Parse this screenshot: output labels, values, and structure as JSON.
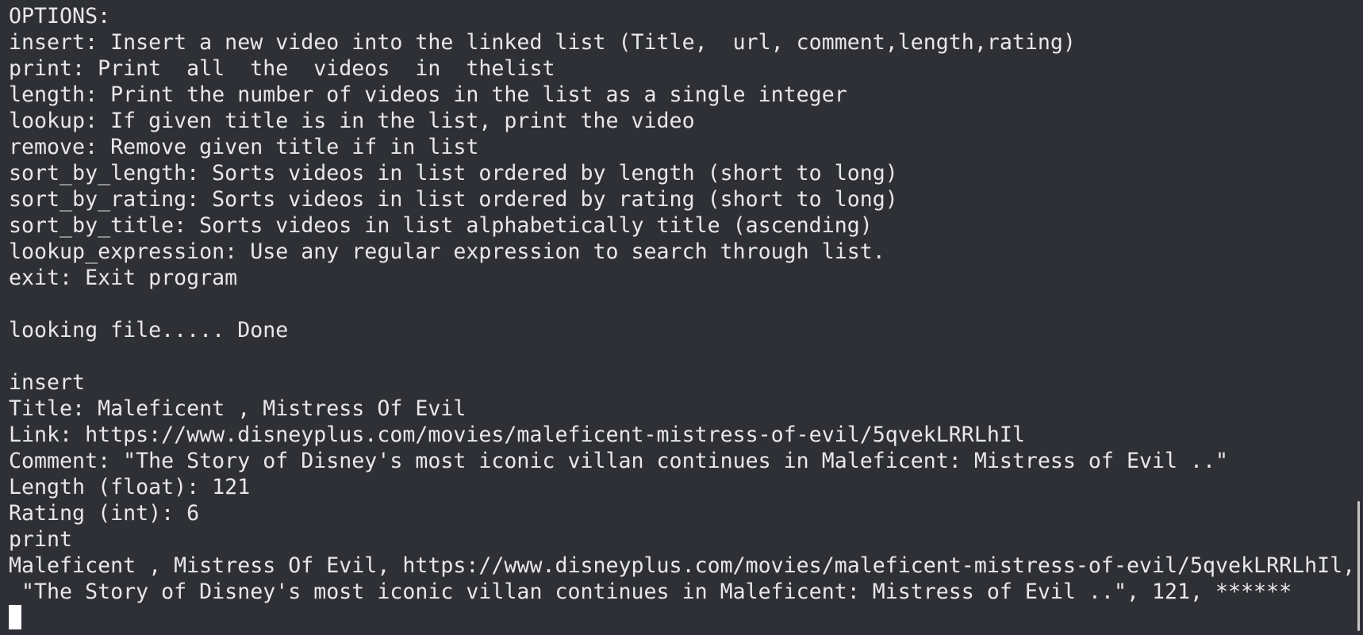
{
  "terminal": {
    "lines": [
      "OPTIONS:",
      "insert: Insert a new video into the linked list (Title,  url, comment,length,rating)",
      "print: Print  all  the  videos  in  thelist",
      "length: Print the number of videos in the list as a single integer",
      "lookup: If given title is in the list, print the video",
      "remove: Remove given title if in list",
      "sort_by_length: Sorts videos in list ordered by length (short to long)",
      "sort_by_rating: Sorts videos in list ordered by rating (short to long)",
      "sort_by_title: Sorts videos in list alphabetically title (ascending)",
      "lookup_expression: Use any regular expression to search through list.",
      "exit: Exit program",
      "",
      "looking file..... Done",
      "",
      "insert",
      "Title: Maleficent , Mistress Of Evil",
      "Link: https://www.disneyplus.com/movies/maleficent-mistress-of-evil/5qvekLRRLhIl",
      "Comment: \"The Story of Disney's most iconic villan continues in Maleficent: Mistress of Evil ..\"",
      "Length (float): 121",
      "Rating (int): 6",
      "print",
      "Maleficent , Mistress Of Evil, https://www.disneyplus.com/movies/maleficent-mistress-of-evil/5qvekLRRLhIl,",
      " \"The Story of Disney's most iconic villan continues in Maleficent: Mistress of Evil ..\", 121, ******"
    ],
    "prompt": ""
  },
  "colors": {
    "background": "#2e3036",
    "foreground": "#e8e8e8",
    "cursor": "#ffffff",
    "scrollbar_thumb": "#c6c6c6"
  }
}
